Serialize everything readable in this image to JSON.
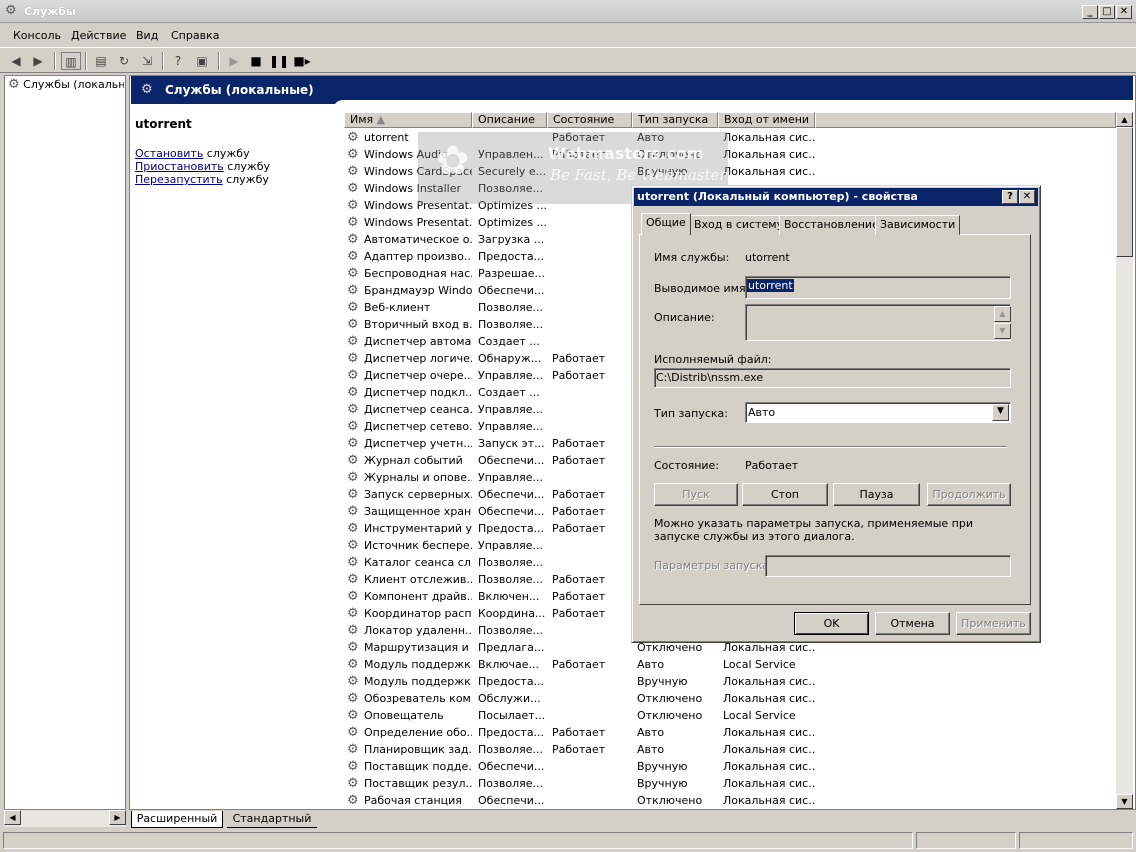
{
  "window": {
    "title": "Службы",
    "min": "_",
    "max": "□",
    "close": "✕"
  },
  "menu": [
    "Консоль",
    "Действие",
    "Вид",
    "Справка"
  ],
  "tree": {
    "item": "Службы (локальные)"
  },
  "main": {
    "header": "Службы (локальные)",
    "selected_service": "utorrent",
    "actions": [
      {
        "link": "Остановить",
        "rest": " службу"
      },
      {
        "link": "Приостановить",
        "rest": " службу"
      },
      {
        "link": "Перезапустить",
        "rest": " службу"
      }
    ],
    "columns": [
      "Имя",
      "Описание",
      "Состояние",
      "Тип запуска",
      "Вход от имени"
    ],
    "rows": [
      [
        "utorrent",
        "",
        "Работает",
        "Авто",
        "Локальная сис..."
      ],
      [
        "Windows Audio",
        "Управлен...",
        "Работает",
        "Отключено",
        "Локальная сис..."
      ],
      [
        "Windows CardSpace",
        "Securely e...",
        "",
        "Вручную",
        "Локальная сис..."
      ],
      [
        "Windows Installer",
        "Позволяе...",
        "",
        "",
        ""
      ],
      [
        "Windows Presentat...",
        "Optimizes ...",
        "",
        "",
        ""
      ],
      [
        "Windows Presentat...",
        "Optimizes ...",
        "",
        "",
        ""
      ],
      [
        "Автоматическое о...",
        "Загрузка ...",
        "",
        "",
        ""
      ],
      [
        "Адаптер произво...",
        "Предоста...",
        "",
        "",
        ""
      ],
      [
        "Беспроводная нас...",
        "Разрешае...",
        "",
        "",
        ""
      ],
      [
        "Брандмауэр Windo...",
        "Обеспечи...",
        "",
        "",
        ""
      ],
      [
        "Веб-клиент",
        "Позволяе...",
        "",
        "",
        ""
      ],
      [
        "Вторичный вход в...",
        "Позволяе...",
        "",
        "",
        ""
      ],
      [
        "Диспетчер автома...",
        "Создает ...",
        "",
        "",
        ""
      ],
      [
        "Диспетчер логиче...",
        "Обнаруж...",
        "Работает",
        "",
        ""
      ],
      [
        "Диспетчер очере...",
        "Управляе...",
        "Работает",
        "",
        ""
      ],
      [
        "Диспетчер подкл...",
        "Создает ...",
        "",
        "",
        ""
      ],
      [
        "Диспетчер сеанса...",
        "Управляе...",
        "",
        "",
        ""
      ],
      [
        "Диспетчер сетево...",
        "Управляе...",
        "",
        "",
        ""
      ],
      [
        "Диспетчер учетн...",
        "Запуск эт...",
        "Работает",
        "",
        ""
      ],
      [
        "Журнал событий",
        "Обеспечи...",
        "Работает",
        "",
        ""
      ],
      [
        "Журналы и опове...",
        "Управляе...",
        "",
        "",
        ""
      ],
      [
        "Запуск серверных...",
        "Обеспечи...",
        "Работает",
        "",
        ""
      ],
      [
        "Защищенное хран...",
        "Обеспечи...",
        "Работает",
        "",
        ""
      ],
      [
        "Инструментарий у...",
        "Предоста...",
        "Работает",
        "",
        ""
      ],
      [
        "Источник беспере...",
        "Управляе...",
        "",
        "",
        ""
      ],
      [
        "Каталог сеанса сл...",
        "Позволяе...",
        "",
        "",
        ""
      ],
      [
        "Клиент отслежив...",
        "Позволяе...",
        "Работает",
        "",
        ""
      ],
      [
        "Компонент драйв...",
        "Включен...",
        "Работает",
        "",
        ""
      ],
      [
        "Координатор расп...",
        "Координа...",
        "Работает",
        "",
        ""
      ],
      [
        "Локатор удаленн...",
        "Позволяе...",
        "",
        "",
        ""
      ],
      [
        "Маршрутизация и ...",
        "Предлага...",
        "",
        "Отключено",
        "Локальная сис..."
      ],
      [
        "Модуль поддержк...",
        "Включае...",
        "Работает",
        "Авто",
        "Local Service"
      ],
      [
        "Модуль поддержк...",
        "Предоста...",
        "",
        "Вручную",
        "Локальная сис..."
      ],
      [
        "Обозреватель ком...",
        "Обслужи...",
        "",
        "Отключено",
        "Локальная сис..."
      ],
      [
        "Оповещатель",
        "Посылает...",
        "",
        "Отключено",
        "Local Service"
      ],
      [
        "Определение обо...",
        "Предоста...",
        "Работает",
        "Авто",
        "Локальная сис..."
      ],
      [
        "Планировщик зад...",
        "Позволяе...",
        "Работает",
        "Авто",
        "Локальная сис..."
      ],
      [
        "Поставщик подде...",
        "Обеспечи...",
        "",
        "Вручную",
        "Локальная сис..."
      ],
      [
        "Поставщик резул...",
        "Позволяе...",
        "",
        "Вручную",
        "Локальная сис..."
      ],
      [
        "Рабочая станция",
        "Обеспечи...",
        "",
        "Отключено",
        "Локальная сис..."
      ]
    ],
    "view_tabs": [
      "Расширенный",
      "Стандартный"
    ]
  },
  "dialog": {
    "title": "utorrent (Локальный компьютер) - свойства",
    "help": "?",
    "close": "✕",
    "tabs": [
      "Общие",
      "Вход в систему",
      "Восстановление",
      "Зависимости"
    ],
    "service_name_label": "Имя службы:",
    "service_name": "utorrent",
    "display_name_label": "Выводимое имя:",
    "display_name": "utorrent",
    "description_label": "Описание:",
    "exe_label": "Исполняемый файл:",
    "exe_path": "C:\\Distrib\\nssm.exe",
    "startup_label": "Тип запуска:",
    "startup_value": "Авто",
    "state_label": "Состояние:",
    "state_value": "Работает",
    "btn_start": "Пуск",
    "btn_stop": "Стоп",
    "btn_pause": "Пауза",
    "btn_resume": "Продолжить",
    "hint": "Можно указать параметры запуска, применяемые при запуске службы из этого диалога.",
    "params_label": "Параметры запуска:",
    "ok": "OK",
    "cancel": "Отмена",
    "apply": "Применить"
  },
  "watermark": {
    "line1": "Webmasters.com",
    "line2": "Be Fast, Be Webmaster"
  }
}
